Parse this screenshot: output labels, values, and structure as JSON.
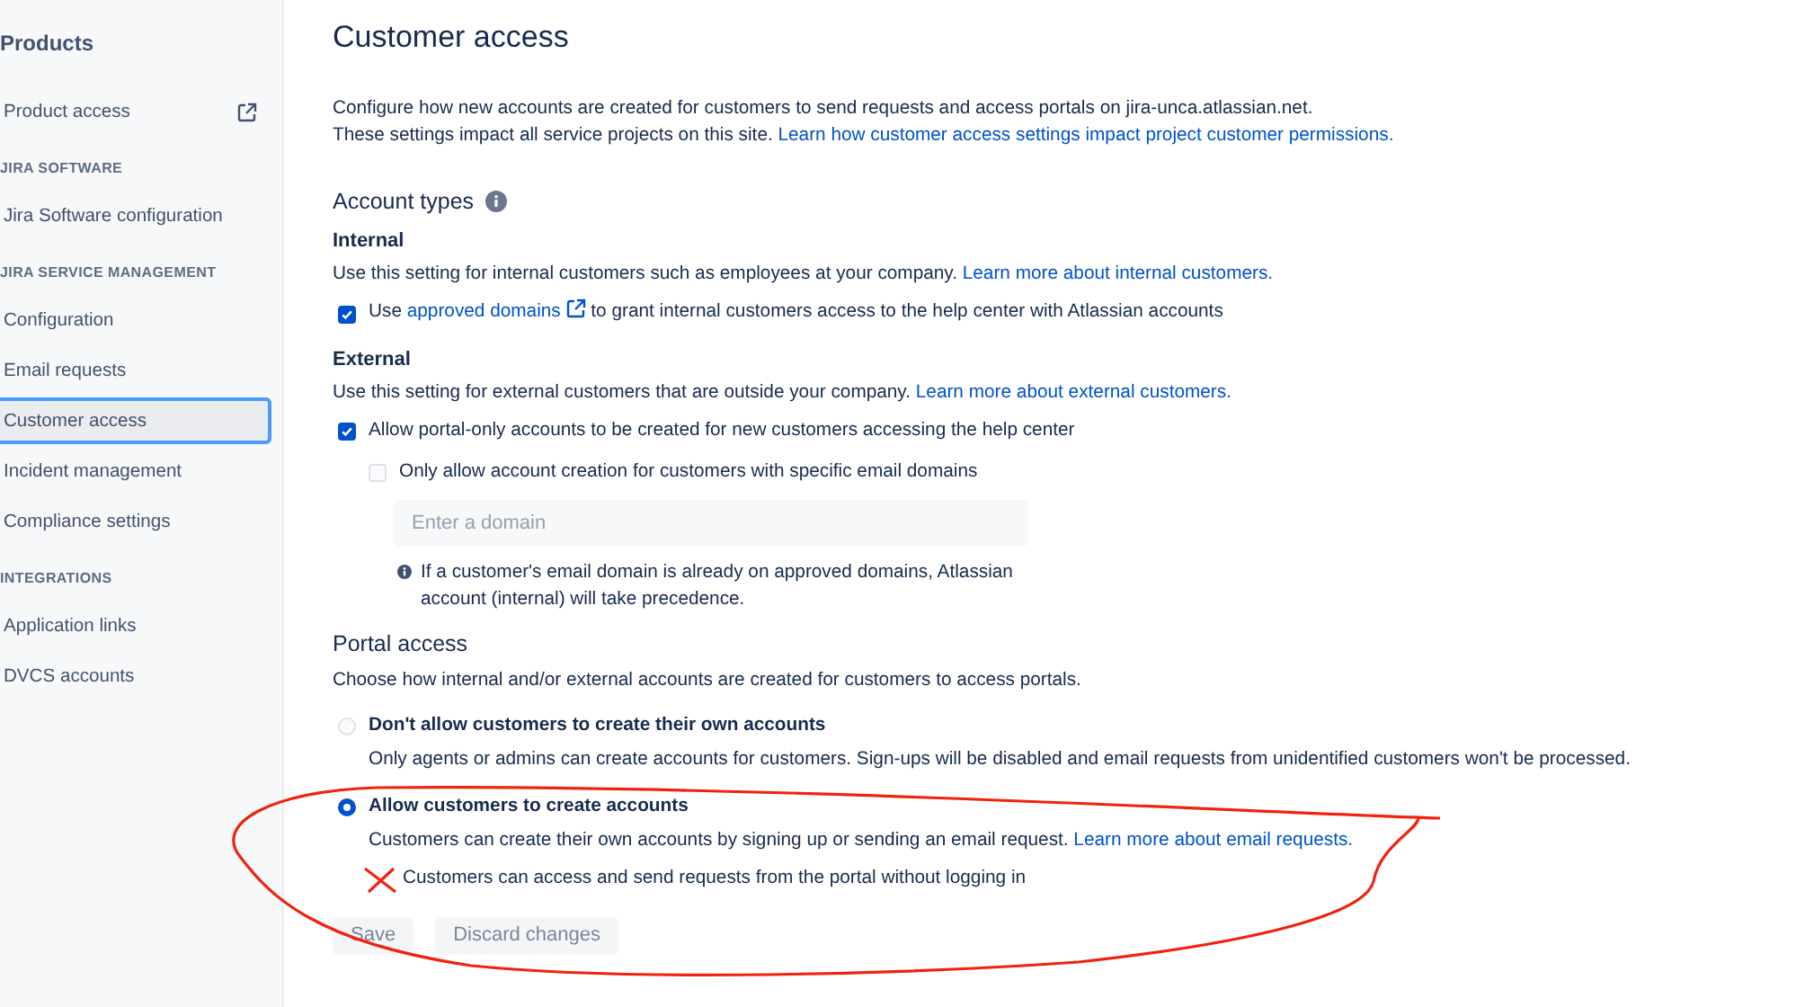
{
  "sidebar": {
    "title": "Products",
    "items": [
      {
        "kind": "link",
        "label": "Product access",
        "external": true,
        "selected": false
      },
      {
        "kind": "heading",
        "label": "JIRA SOFTWARE"
      },
      {
        "kind": "link",
        "label": "Jira Software configuration",
        "external": false,
        "selected": false
      },
      {
        "kind": "heading",
        "label": "JIRA SERVICE MANAGEMENT"
      },
      {
        "kind": "link",
        "label": "Configuration",
        "external": false,
        "selected": false
      },
      {
        "kind": "link",
        "label": "Email requests",
        "external": false,
        "selected": false
      },
      {
        "kind": "link",
        "label": "Customer access",
        "external": false,
        "selected": true
      },
      {
        "kind": "link",
        "label": "Incident management",
        "external": false,
        "selected": false
      },
      {
        "kind": "link",
        "label": "Compliance settings",
        "external": false,
        "selected": false
      },
      {
        "kind": "heading",
        "label": "INTEGRATIONS"
      },
      {
        "kind": "link",
        "label": "Application links",
        "external": false,
        "selected": false
      },
      {
        "kind": "link",
        "label": "DVCS accounts",
        "external": false,
        "selected": false
      }
    ]
  },
  "page": {
    "title": "Customer access",
    "description": {
      "lines": [
        "Configure how new accounts are created for customers to send requests and access portals on jira-unca.atlassian.net.",
        "These settings impact all service projects on this site."
      ],
      "link": "Learn how customer access settings impact project customer permissions."
    },
    "account_types": {
      "heading": "Account types",
      "internal": {
        "heading": "Internal",
        "text": "Use this setting for internal customers such as employees at your company.",
        "link": "Learn more about internal customers.",
        "checkbox": {
          "checked": true,
          "before": "Use",
          "link": "approved domains",
          "after": "to grant internal customers access to the help center with Atlassian accounts"
        }
      },
      "external": {
        "heading": "External",
        "text": "Use this setting for external customers that are outside your company.",
        "link": "Learn more about external customers.",
        "checkbox": {
          "checked": true,
          "label": "Allow portal-only accounts to be created for new customers accessing the help center"
        },
        "sub_checkbox": {
          "checked": false,
          "label": "Only allow account creation for customers with specific email domains"
        },
        "domain_field": {
          "placeholder": "Enter a domain"
        },
        "note": "If a customer's email domain is already on approved domains, Atlassian account (internal) will take precedence."
      }
    },
    "portal_access": {
      "heading": "Portal access",
      "text": "Choose how internal and/or external accounts are created for customers to access portals.",
      "options": [
        {
          "label": "Don't allow customers to create their own accounts",
          "description": "Only agents or admins can create accounts for customers. Sign-ups will be disabled and email requests from unidentified customers won't be processed.",
          "selected": false
        },
        {
          "label": "Allow customers to create accounts",
          "description": "Customers can create their own accounts by signing up or sending an email request.",
          "link": "Learn more about email requests.",
          "selected": true
        }
      ],
      "sub_checkbox": {
        "label": "Customers can access and send requests from the portal without logging in"
      }
    },
    "buttons": [
      {
        "label": "Save",
        "disabled": true
      },
      {
        "label": "Discard changes",
        "disabled": true
      }
    ]
  }
}
